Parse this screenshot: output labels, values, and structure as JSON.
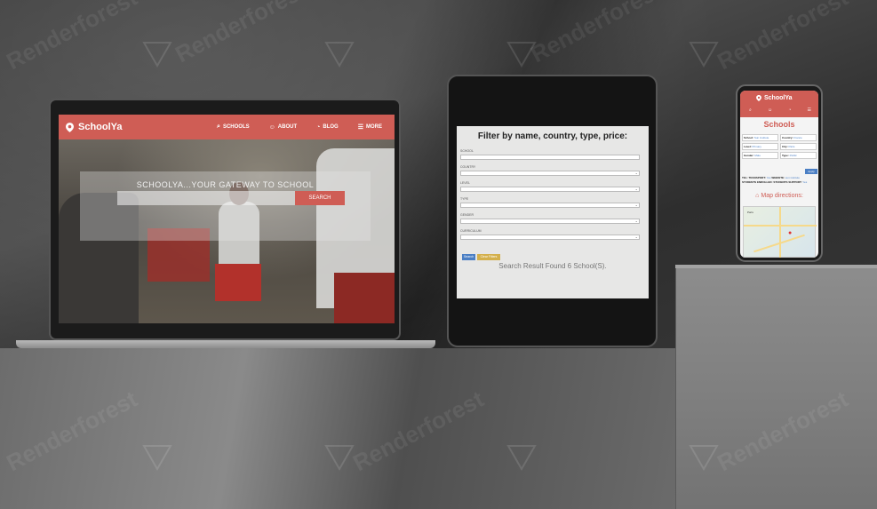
{
  "laptop_site": {
    "logo": "SchoolYa",
    "nav": [
      {
        "icon": "search-icon",
        "label": "SCHOOLS"
      },
      {
        "icon": "user-icon",
        "label": "ABOUT"
      },
      {
        "icon": "rss-icon",
        "label": "BLOG"
      },
      {
        "icon": "menu-icon",
        "label": "MORE"
      }
    ],
    "hero_title": "SCHOOLYA...YOUR GATEWAY TO SCHOOL",
    "search_button": "SEARCH"
  },
  "tablet_site": {
    "title": "Filter by name, country, type, price:",
    "filters": [
      "SCHOOL",
      "COUNTRY",
      "LEVEL",
      "TYPE",
      "GENDER",
      "CURRICULUM"
    ],
    "search_button": "Search",
    "clear_button": "Clear Filters",
    "result": "Search Result Found 6 School(S)."
  },
  "phone_site": {
    "logo": "SchoolYa",
    "title": "Schools",
    "grid": [
      {
        "label": "School:",
        "value": "Sun institute"
      },
      {
        "label": "Country:",
        "value": "France"
      },
      {
        "label": "Level:",
        "value": "Primary"
      },
      {
        "label": "City:",
        "value": "Paris"
      },
      {
        "label": "Gender:",
        "value": "Male"
      },
      {
        "label": "Type:",
        "value": "Public"
      }
    ],
    "apply_button": "Apply",
    "info_line1": "TEL:",
    "info_line1_b": "TRANSPORT:",
    "info_line1_c": "Yes",
    "info_line1_d": "WEBSITE:",
    "info_line1_e": "sun institute",
    "info_line2": "STUDENTS ENROLLED:",
    "info_line2_b": "STUDENTS SUPPORT:",
    "info_line2_c": "Yes",
    "map_title": "Map directions:",
    "map_label": "Paris"
  },
  "watermark": "Renderforest",
  "colors": {
    "brand_red": "#cf5d55",
    "link_blue": "#4b7fc4",
    "clear_yellow": "#d4b04c"
  }
}
